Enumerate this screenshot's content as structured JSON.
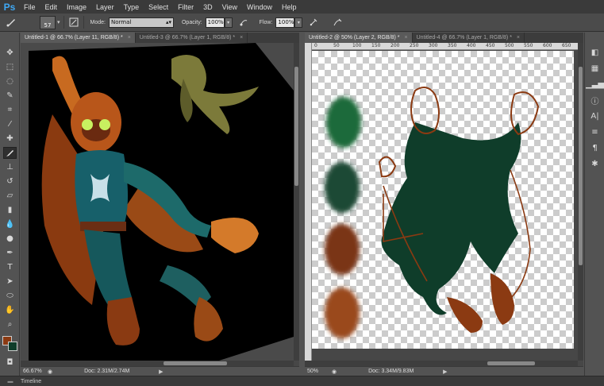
{
  "app": {
    "logo": "Ps"
  },
  "menu": [
    "File",
    "Edit",
    "Image",
    "Layer",
    "Type",
    "Select",
    "Filter",
    "3D",
    "View",
    "Window",
    "Help"
  ],
  "options": {
    "brush_size": "57",
    "mode_label": "Mode:",
    "mode_value": "Normal",
    "opacity_label": "Opacity:",
    "opacity_value": "100%",
    "flow_label": "Flow:",
    "flow_value": "100%"
  },
  "left_doc": {
    "tabs": [
      {
        "label": "Untitled-1 @ 66.7% (Layer 11, RGB/8) *",
        "close": "×"
      },
      {
        "label": "Untitled-3 @ 66.7% (Layer 1, RGB/8) *",
        "close": "×"
      }
    ],
    "zoom": "66.67%",
    "doc_size": "Doc: 2.31M/2.74M"
  },
  "right_doc": {
    "tabs": [
      {
        "label": "Untitled-2 @ 50% (Layer 2, RGB/8) *",
        "close": "×"
      },
      {
        "label": "Untitled-4 @ 66.7% (Layer 1, RGB/8) *",
        "close": "×"
      }
    ],
    "ruler": [
      "0",
      "50",
      "100",
      "150",
      "200",
      "250",
      "300",
      "350",
      "400",
      "450",
      "500",
      "550",
      "600",
      "650"
    ],
    "zoom": "50%",
    "doc_size": "Doc: 3.34M/9.83M"
  },
  "swatches": [
    "#1e6b3a",
    "#1b4a36",
    "#7a3518",
    "#9a4a1e"
  ],
  "colors": {
    "foreground": "#8b3a12",
    "background": "#0f3d2a"
  },
  "timeline_label": "Timeline"
}
